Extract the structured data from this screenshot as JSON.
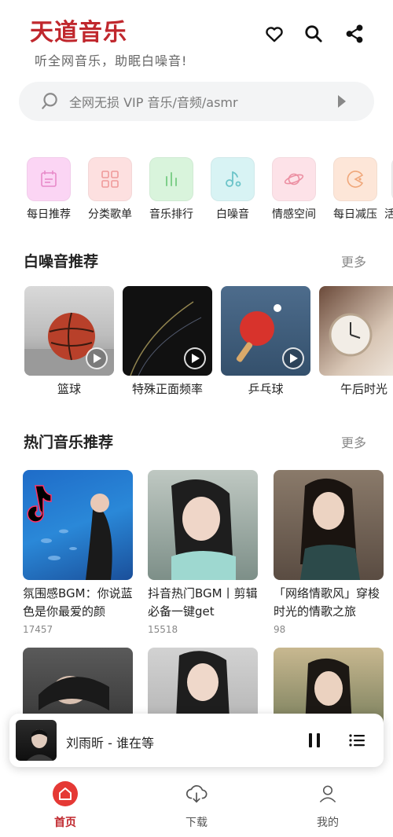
{
  "header": {
    "title": "天道音乐",
    "subtitle": "听全网音乐，助眠白噪音!"
  },
  "icons": {
    "favorite": "heart-icon",
    "search": "search-icon",
    "share": "share-icon"
  },
  "search": {
    "placeholder": "全网无损 VIP 音乐/音频/asmr"
  },
  "categories": [
    {
      "label": "每日推荐",
      "icon": "calendar-icon",
      "color": "#fbd5f4"
    },
    {
      "label": "分类歌单",
      "icon": "grid-icon",
      "color": "#fde0e0"
    },
    {
      "label": "音乐排行",
      "icon": "bar-chart-icon",
      "color": "#d9f4dc"
    },
    {
      "label": "白噪音",
      "icon": "music-note-icon",
      "color": "#d8f3f4"
    },
    {
      "label": "情感空间",
      "icon": "planet-icon",
      "color": "#fde2e8"
    },
    {
      "label": "每日减压",
      "icon": "pacman-icon",
      "color": "#fde6d8"
    },
    {
      "label": "活",
      "icon": "partial-icon",
      "color": "#eeeeee"
    }
  ],
  "white_noise": {
    "title": "白噪音推荐",
    "more": "更多",
    "items": [
      {
        "name": "篮球"
      },
      {
        "name": "特殊正面频率"
      },
      {
        "name": "乒乓球"
      },
      {
        "name": "午后时光"
      }
    ]
  },
  "hot_music": {
    "title": "热门音乐推荐",
    "more": "更多",
    "items": [
      {
        "title": "氛围感BGM：你说蓝色是你最爱的颜",
        "count": "17457"
      },
      {
        "title": "抖音热门BGM丨剪辑必备一键get",
        "count": "15518"
      },
      {
        "title": "「网络情歌风」穿梭时光的情歌之旅",
        "count": "98"
      },
      {
        "title": "",
        "count": ""
      },
      {
        "title": "",
        "count": ""
      },
      {
        "title": "",
        "count": ""
      }
    ]
  },
  "player": {
    "track": "刘雨昕 - 谁在等"
  },
  "tabs": [
    {
      "label": "首页",
      "active": true
    },
    {
      "label": "下载",
      "active": false
    },
    {
      "label": "我的",
      "active": false
    }
  ],
  "colors": {
    "accent": "#c0272d",
    "search_bg": "#f3f4f5"
  }
}
